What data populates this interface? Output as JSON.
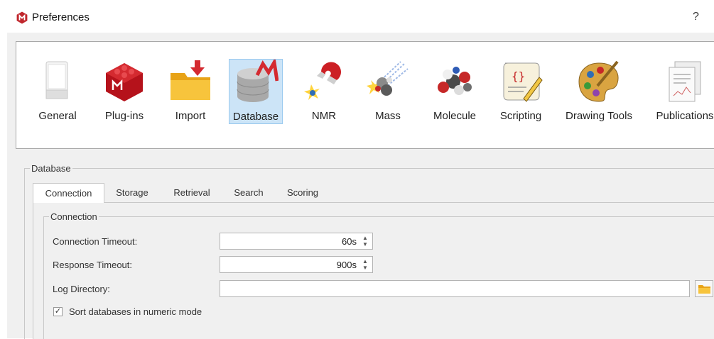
{
  "window": {
    "title": "Preferences",
    "help_label": "?"
  },
  "toolbar": {
    "items": [
      {
        "label": "General",
        "icon": "general-icon"
      },
      {
        "label": "Plug-ins",
        "icon": "plugins-icon"
      },
      {
        "label": "Import",
        "icon": "import-icon"
      },
      {
        "label": "Database",
        "icon": "database-icon",
        "selected": true
      },
      {
        "label": "NMR",
        "icon": "nmr-icon"
      },
      {
        "label": "Mass",
        "icon": "mass-icon"
      },
      {
        "label": "Molecule",
        "icon": "molecule-icon"
      },
      {
        "label": "Scripting",
        "icon": "scripting-icon"
      },
      {
        "label": "Drawing Tools",
        "icon": "drawing-tools-icon"
      },
      {
        "label": "Publications",
        "icon": "publications-icon"
      }
    ]
  },
  "database_group": {
    "title": "Database"
  },
  "tabs": [
    {
      "label": "Connection",
      "active": true
    },
    {
      "label": "Storage"
    },
    {
      "label": "Retrieval"
    },
    {
      "label": "Search"
    },
    {
      "label": "Scoring"
    }
  ],
  "connection_group": {
    "title": "Connection",
    "connection_timeout": {
      "label": "Connection Timeout:",
      "value": "60s"
    },
    "response_timeout": {
      "label": "Response Timeout:",
      "value": "900s"
    },
    "log_directory": {
      "label": "Log Directory:",
      "value": ""
    },
    "sort_numeric": {
      "label": "Sort databases in numeric mode",
      "checked": true,
      "check_glyph": "✓"
    }
  },
  "colors": {
    "selection": "#cce4f7",
    "selection_border": "#99c9ef",
    "brand": "#c0272d",
    "background": "#f0f0f0"
  }
}
